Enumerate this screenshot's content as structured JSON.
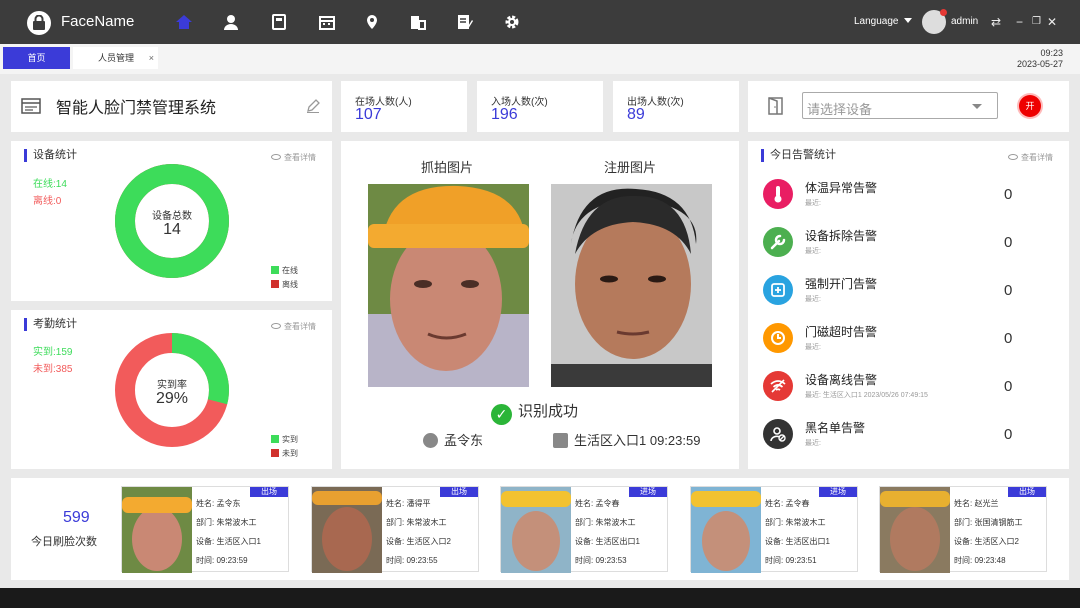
{
  "app": {
    "title": "FaceName"
  },
  "nav": [
    "home-icon",
    "person-icon",
    "calculator-icon",
    "calendar-icon",
    "location-icon",
    "building-icon",
    "edit-icon",
    "gear-icon"
  ],
  "header": {
    "language": "Language",
    "user": "admin"
  },
  "tabs": [
    {
      "label": "首页"
    },
    {
      "label": "人员管理"
    }
  ],
  "clock": {
    "time": "09:23",
    "date": "2023-05-27"
  },
  "system": {
    "title": "智能人脸门禁管理系统"
  },
  "stats": [
    {
      "label": "在场人数(人)",
      "value": "107"
    },
    {
      "label": "入场人数(次)",
      "value": "196"
    },
    {
      "label": "出场人数(次)",
      "value": "89"
    }
  ],
  "device_select": {
    "placeholder": "请选择设备",
    "open_label": "开"
  },
  "view_detail": "查看详情",
  "device_stats": {
    "title": "设备统计",
    "online_text": "在线:14",
    "offline_text": "离线:0",
    "center_label": "设备总数",
    "total": "14",
    "legend_online": "在线",
    "legend_offline": "离线",
    "online_fraction": 1.0
  },
  "attendance": {
    "title": "考勤统计",
    "present_text": "实到:159",
    "absent_text": "未到:385",
    "center_label": "实到率",
    "rate": "29%",
    "legend_present": "实到",
    "legend_absent": "未到",
    "present_fraction": 0.29
  },
  "capture": {
    "snap_title": "抓拍图片",
    "reg_title": "注册图片",
    "result": "识别成功",
    "name": "孟令东",
    "location_time": "生活区入口1 09:23:59"
  },
  "alarms": {
    "title": "今日告警统计",
    "items": [
      {
        "name": "体温异常告警",
        "sub": "最近:",
        "count": "0",
        "color": "#e91e63",
        "icon": "thermometer-icon"
      },
      {
        "name": "设备拆除告警",
        "sub": "最近:",
        "count": "0",
        "color": "#4caf50",
        "icon": "wrench-icon"
      },
      {
        "name": "强制开门告警",
        "sub": "最近:",
        "count": "0",
        "color": "#29a3e0",
        "icon": "door-force-icon"
      },
      {
        "name": "门磁超时告警",
        "sub": "最近:",
        "count": "0",
        "color": "#ff9800",
        "icon": "clock-icon"
      },
      {
        "name": "设备离线告警",
        "sub": "最近: 生活区入口1 2023/05/26 07:49:15",
        "count": "0",
        "color": "#e53935",
        "icon": "wifi-off-icon"
      },
      {
        "name": "黑名单告警",
        "sub": "最近:",
        "count": "0",
        "color": "#333333",
        "icon": "person-block-icon"
      }
    ]
  },
  "today_swipes": {
    "count": "599",
    "label": "今日刷脸次数"
  },
  "records": [
    {
      "name": "姓名: 孟令东",
      "dept": "部门: 朱常波木工",
      "device": "设备: 生活区入口1",
      "time": "时间: 09:23:59",
      "badge": "出场"
    },
    {
      "name": "姓名: 潘得平",
      "dept": "部门: 朱常波木工",
      "device": "设备: 生活区入口2",
      "time": "时间: 09:23:55",
      "badge": "出场"
    },
    {
      "name": "姓名: 孟令春",
      "dept": "部门: 朱常波木工",
      "device": "设备: 生活区出口1",
      "time": "时间: 09:23:53",
      "badge": "进场"
    },
    {
      "name": "姓名: 孟令春",
      "dept": "部门: 朱常波木工",
      "device": "设备: 生活区出口1",
      "time": "时间: 09:23:51",
      "badge": "进场"
    },
    {
      "name": "姓名: 赵光兰",
      "dept": "部门: 张国清钢筋工",
      "device": "设备: 生活区入口2",
      "time": "时间: 09:23:48",
      "badge": "出场"
    }
  ]
}
